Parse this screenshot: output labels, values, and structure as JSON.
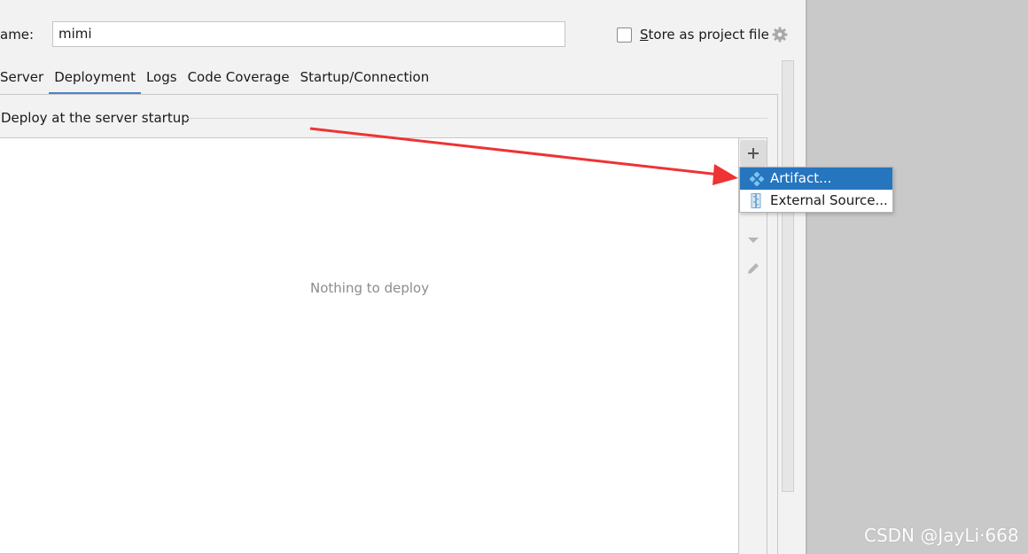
{
  "header": {
    "name_label": "ame:",
    "name_value": "mimi",
    "store_label_prefix": "S",
    "store_label_rest": "tore as project file",
    "store_checked": false
  },
  "tabs": [
    {
      "label": "Server",
      "active": false
    },
    {
      "label": "Deployment",
      "active": true
    },
    {
      "label": "Logs",
      "active": false
    },
    {
      "label": "Code Coverage",
      "active": false
    },
    {
      "label": "Startup/Connection",
      "active": false
    }
  ],
  "deploy": {
    "section_title": "Deploy at the server startup",
    "empty_text": "Nothing to deploy"
  },
  "toolbar": {
    "add_icon": "plus-icon",
    "down_icon": "arrow-down-icon",
    "edit_icon": "pencil-icon"
  },
  "popup": {
    "items": [
      {
        "label": "Artifact...",
        "icon": "artifact-icon",
        "selected": true
      },
      {
        "label": "External Source...",
        "icon": "external-source-icon",
        "selected": false
      }
    ]
  },
  "colors": {
    "accent": "#2675bf",
    "tab_underline": "#4a84c8",
    "annotation_arrow": "#ee3333"
  },
  "watermark": "CSDN @JayLi·668"
}
